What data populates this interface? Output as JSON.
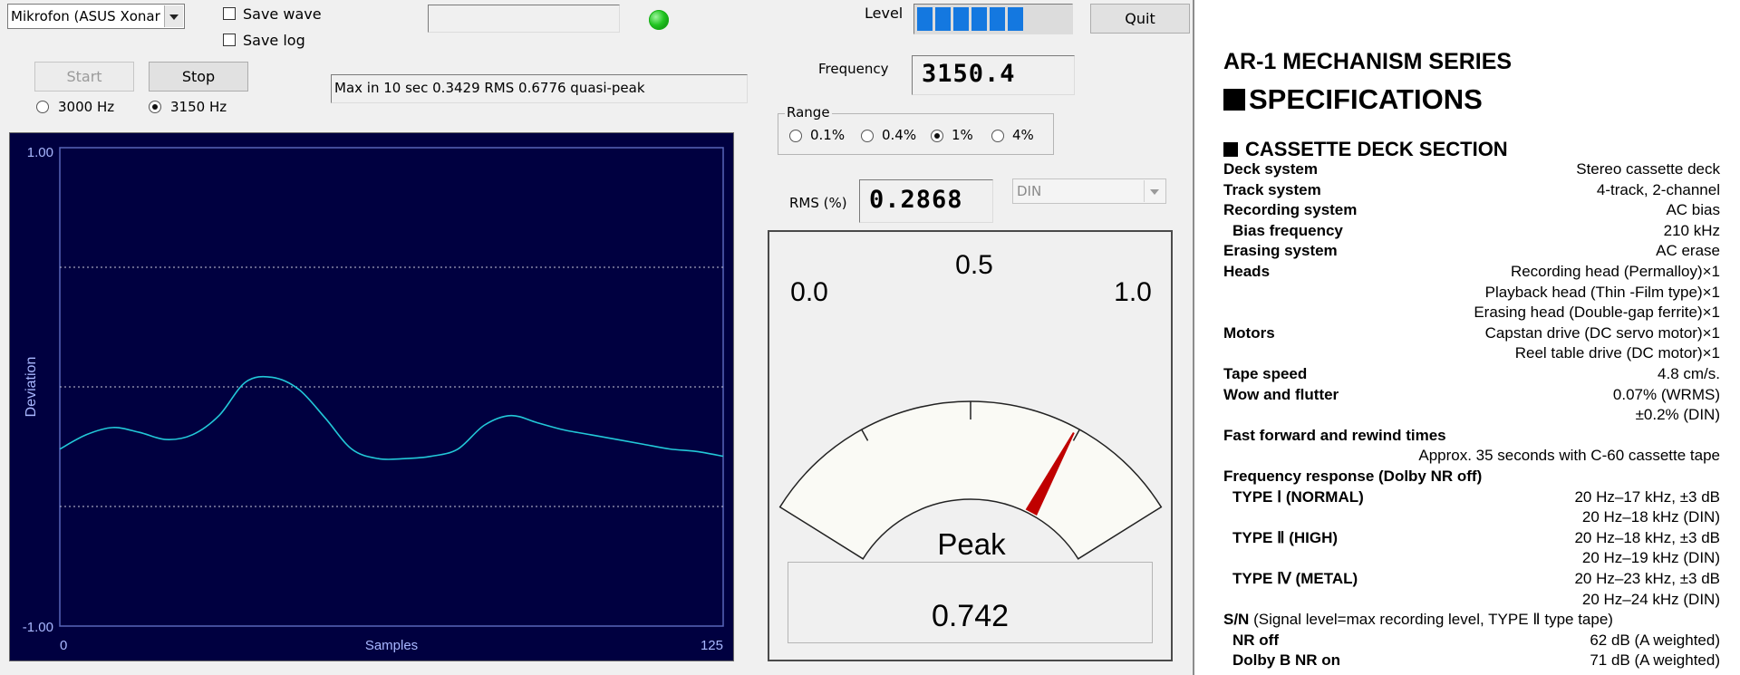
{
  "app": {
    "device_select": {
      "value": "Mikrofon (ASUS Xonar I"
    },
    "save_wave": {
      "label": "Save wave",
      "checked": false
    },
    "save_log": {
      "label": "Save log",
      "checked": false
    },
    "level_label": "Level",
    "level_segments": 6,
    "level_colors": {
      "on": "#1478e0",
      "off": "#d8d8d8"
    },
    "quit_label": "Quit",
    "start_label": "Start",
    "stop_label": "Stop",
    "status_text": "Max in 10 sec 0.3429 RMS 0.6776 quasi-peak",
    "frequency_label": "Frequency",
    "frequency_value": "3150.4",
    "ref_freq": {
      "options": [
        {
          "label": "3000 Hz",
          "checked": false
        },
        {
          "label": "3150 Hz",
          "checked": true
        }
      ]
    },
    "range": {
      "label": "Range",
      "options": [
        {
          "label": "0.1%",
          "checked": false
        },
        {
          "label": "0.4%",
          "checked": false
        },
        {
          "label": "1%",
          "checked": true
        },
        {
          "label": "4%",
          "checked": false
        }
      ]
    },
    "rms_label": "RMS (%)",
    "rms_value": "0.2868",
    "weighting_select": {
      "value": "DIN"
    },
    "indicator_color": "#18b018",
    "meter": {
      "scale_labels": [
        "0.0",
        "0.5",
        "1.0"
      ],
      "title": "Peak",
      "peak_display": "0.742",
      "needle_value": 0.742,
      "needle_color": "#c00000",
      "face_color": "#fafaf5"
    }
  },
  "chart_data": {
    "type": "line",
    "title": "",
    "xlabel": "Samples",
    "ylabel": "Deviation",
    "xlim": [
      0,
      125
    ],
    "ylim": [
      -1.0,
      1.0
    ],
    "x_tick_labels": [
      "0",
      "125"
    ],
    "y_tick_labels": [
      "1.00",
      "-1.00"
    ],
    "gridlines_y": [
      0.5,
      0.0,
      -0.5
    ],
    "line_color": "#22c8d8",
    "background": "#000040",
    "series": [
      {
        "x": [
          0,
          5,
          10,
          15,
          20,
          25,
          30,
          35,
          40,
          45,
          50,
          55,
          60,
          65,
          70,
          75,
          80,
          85,
          90,
          95,
          100,
          105,
          110,
          115,
          120,
          125
        ],
        "y": [
          -0.26,
          -0.2,
          -0.17,
          -0.19,
          -0.22,
          -0.2,
          -0.12,
          0.02,
          0.04,
          -0.01,
          -0.13,
          -0.26,
          -0.3,
          -0.3,
          -0.29,
          -0.26,
          -0.16,
          -0.12,
          -0.15,
          -0.18,
          -0.2,
          -0.22,
          -0.24,
          -0.26,
          -0.27,
          -0.29
        ]
      }
    ]
  },
  "doc": {
    "series_title": "AR-1 MECHANISM SERIES",
    "section_title": "SPECIFICATIONS",
    "subsection_title": "CASSETTE DECK SECTION",
    "rows": [
      {
        "key": "Deck system",
        "value": "Stereo cassette deck"
      },
      {
        "key": "Track system",
        "value": "4-track, 2-channel"
      },
      {
        "key": "Recording system",
        "value": "AC bias"
      },
      {
        "key": "Bias frequency",
        "value": "210 kHz",
        "indent": true
      },
      {
        "key": "Erasing system",
        "value": "AC erase"
      },
      {
        "key": "Heads",
        "value": "Recording  head (Permalloy)×1"
      },
      {
        "key": "",
        "value": "Playback head (Thin -Film type)×1"
      },
      {
        "key": "",
        "value": "Erasing head (Double-gap ferrite)×1"
      },
      {
        "key": "Motors",
        "value": "Capstan drive (DC servo motor)×1"
      },
      {
        "key": "",
        "value": "Reel table drive (DC motor)×1"
      },
      {
        "key": "Tape speed",
        "value": "4.8 cm/s."
      },
      {
        "key": "Wow and flutter",
        "value": "0.07% (WRMS)"
      },
      {
        "key": "",
        "value": "±0.2% (DIN)"
      },
      {
        "key": "Fast forward and rewind times",
        "value": ""
      },
      {
        "key": "",
        "value": "Approx. 35 seconds with C-60 cassette tape"
      },
      {
        "key": "Frequency response (Dolby NR off)",
        "value": ""
      },
      {
        "key": "TYPE Ⅰ (NORMAL)",
        "value": "20 Hz–17 kHz, ±3 dB",
        "indent": true
      },
      {
        "key": "",
        "value": "20 Hz–18 kHz (DIN)"
      },
      {
        "key": "TYPE Ⅱ (HIGH)",
        "value": "20 Hz–18 kHz, ±3 dB",
        "indent": true
      },
      {
        "key": "",
        "value": "20 Hz–19 kHz (DIN)"
      },
      {
        "key": "TYPE Ⅳ (METAL)",
        "value": "20 Hz–23 kHz, ±3 dB",
        "indent": true
      },
      {
        "key": "",
        "value": "20 Hz–24 kHz (DIN)"
      },
      {
        "key": "S/N",
        "value": "",
        "note": " (Signal level=max recording level, TYPE Ⅱ type tape)"
      },
      {
        "key": "NR off",
        "value": "62 dB (A weighted)",
        "indent": true
      },
      {
        "key": "Dolby B NR on",
        "value": "71 dB (A weighted)",
        "indent": true
      }
    ]
  }
}
